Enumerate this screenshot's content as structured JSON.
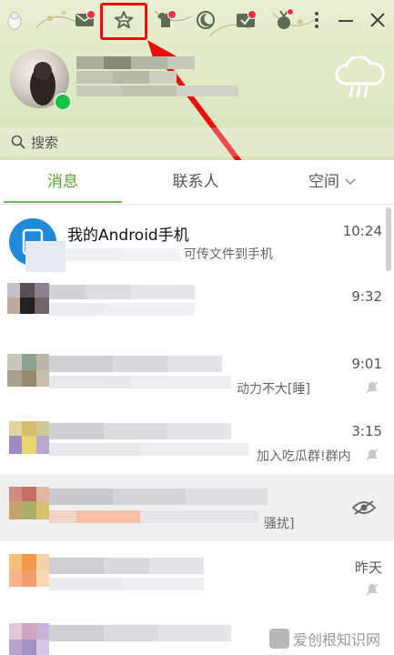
{
  "header": {
    "search_placeholder": "搜索"
  },
  "toolbar": {
    "buttons": [
      {
        "name": "mail-icon"
      },
      {
        "name": "star-icon"
      },
      {
        "name": "shirt-icon"
      },
      {
        "name": "moon-icon"
      },
      {
        "name": "check-mail-icon"
      },
      {
        "name": "medal-icon"
      },
      {
        "name": "more-icon"
      },
      {
        "name": "minimize-icon"
      },
      {
        "name": "close-icon"
      }
    ]
  },
  "tabs": [
    {
      "label": "消息",
      "active": true
    },
    {
      "label": "联系人",
      "active": false
    },
    {
      "label": "空间",
      "active": false
    }
  ],
  "messages": [
    {
      "title": "我的Android手机",
      "snippet": "可传文件到手机",
      "time": "10:24"
    },
    {
      "title": "",
      "snippet": "",
      "time": "9:32"
    },
    {
      "title": "",
      "snippet": "动力不大[睡]",
      "time": "9:01"
    },
    {
      "title": "",
      "snippet": "加入吃瓜群!群内",
      "time": "3:15"
    },
    {
      "title": "",
      "snippet": "骚扰]",
      "time": ""
    },
    {
      "title": "",
      "snippet": "",
      "time": "昨天"
    },
    {
      "title": "",
      "snippet": "",
      "time": ""
    }
  ],
  "watermark": "爱创根知识网",
  "colors": {
    "accent": "#5aa134",
    "highlight": "#f00a0a",
    "online": "#18c24a"
  }
}
